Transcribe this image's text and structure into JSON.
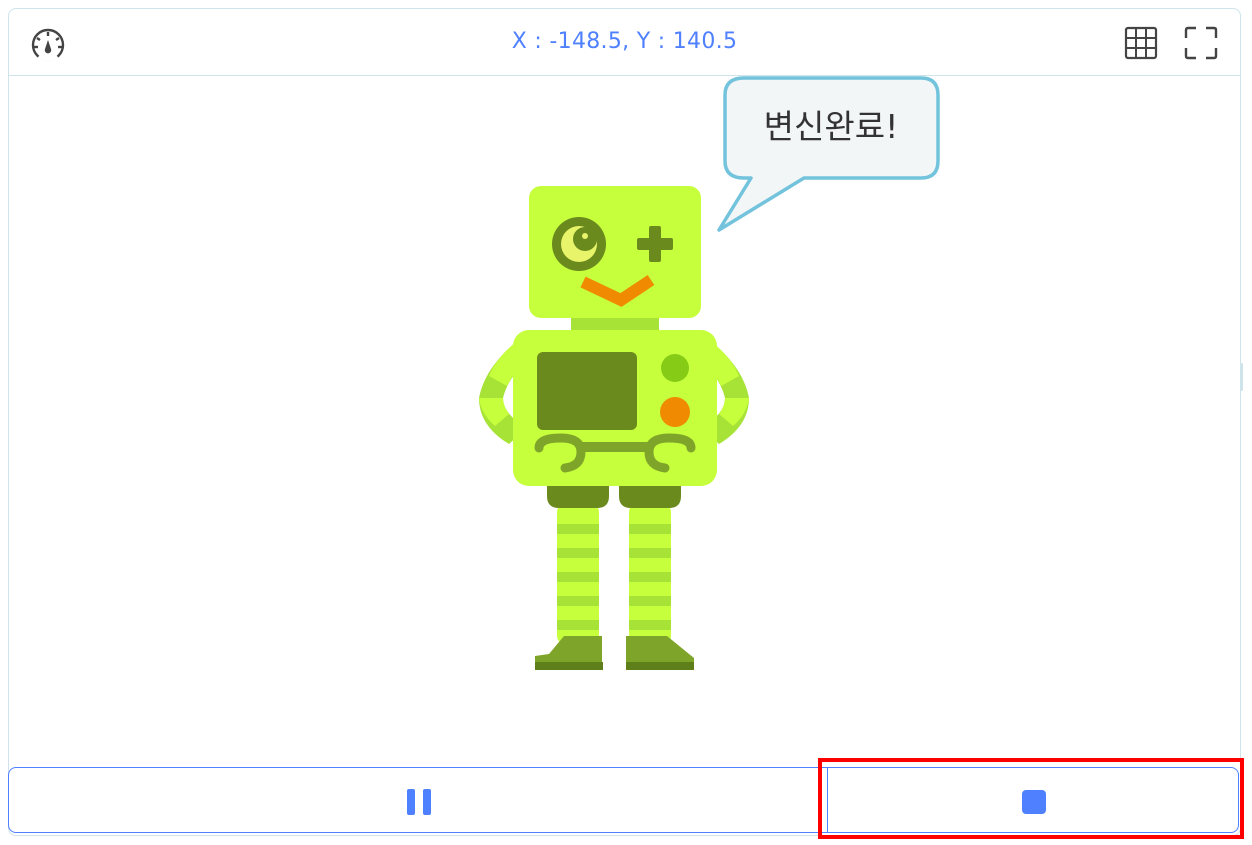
{
  "toolbar": {
    "coordinate_readout": "X : -148.5, Y : 140.5",
    "speed_icon": "speedometer-icon",
    "grid_icon": "grid-icon",
    "fullscreen_icon": "fullscreen-icon"
  },
  "stage": {
    "sprite_name": "robot",
    "speech_bubble": "변신완료!"
  },
  "controls": {
    "pause_icon": "pause-icon",
    "stop_icon": "stop-icon"
  },
  "colors": {
    "accent": "#4f80ff",
    "border": "#cfe3ea",
    "highlight": "#ff0000",
    "robot_body": "#c6ff3c",
    "robot_dark": "#6b8a1e",
    "robot_stripe": "#a6e336",
    "robot_orange": "#f08a00"
  }
}
